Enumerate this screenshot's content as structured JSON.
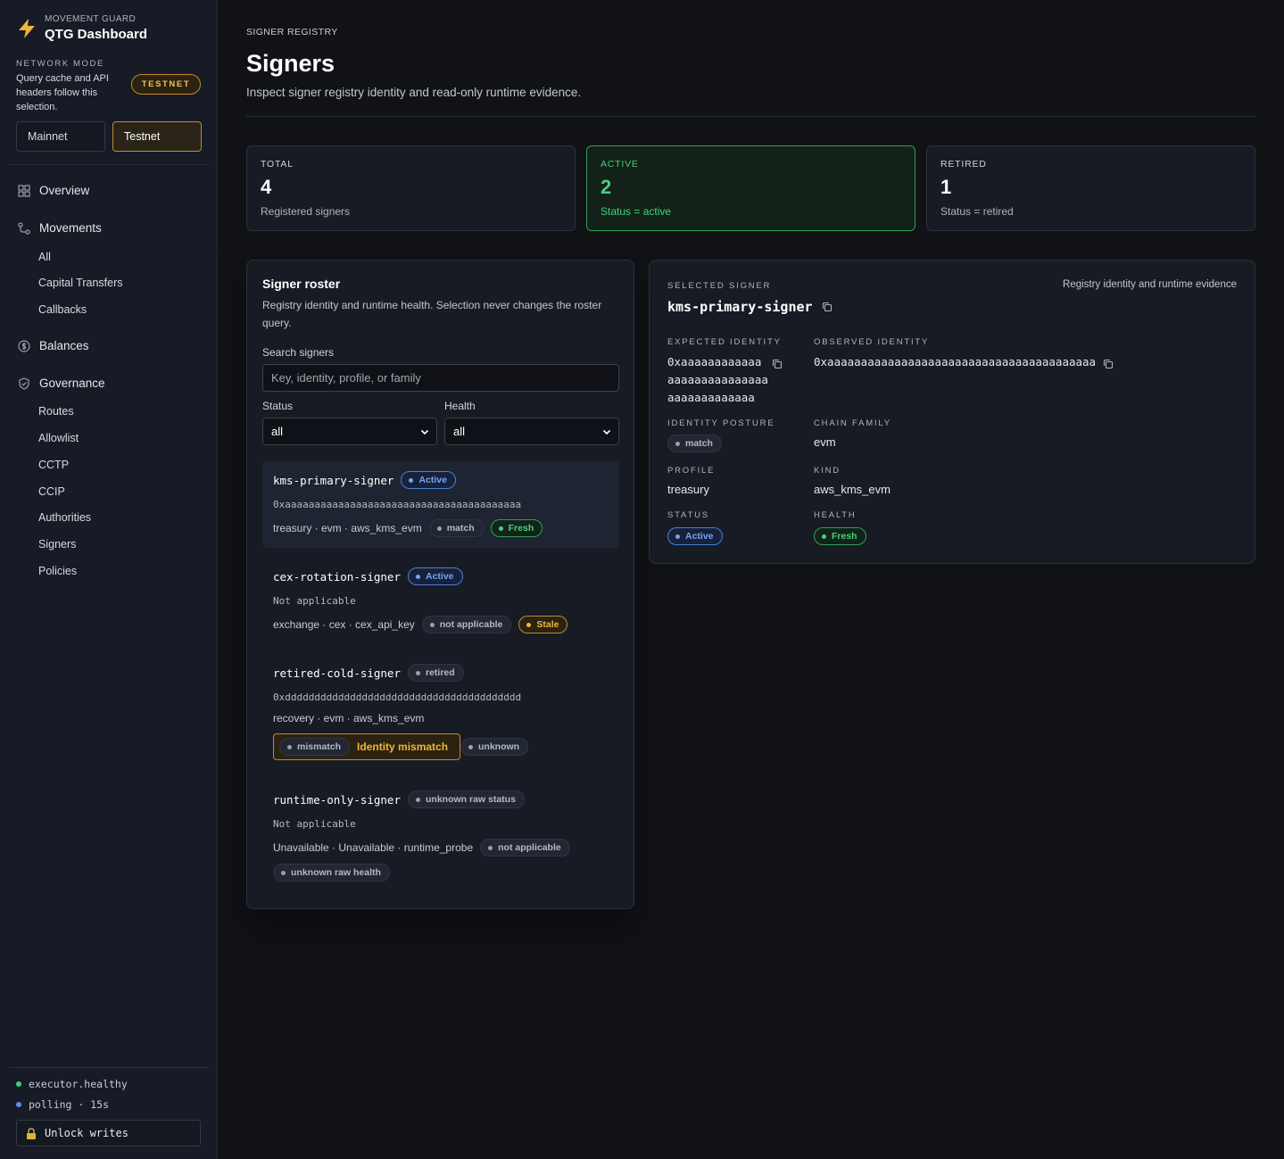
{
  "app": {
    "eyebrow": "MOVEMENT GUARD",
    "title": "QTG Dashboard",
    "accent": "#f0b43a"
  },
  "network_mode": {
    "label": "NETWORK MODE",
    "description": "Query cache and API headers follow this selection.",
    "current_badge": "TESTNET",
    "options": [
      "Mainnet",
      "Testnet"
    ],
    "selected": "Testnet"
  },
  "nav": {
    "overview": "Overview",
    "movements": "Movements",
    "movements_items": [
      "All",
      "Capital Transfers",
      "Callbacks"
    ],
    "balances": "Balances",
    "governance": "Governance",
    "governance_items": [
      "Routes",
      "Allowlist",
      "CCTP",
      "CCIP",
      "Authorities",
      "Signers",
      "Policies"
    ]
  },
  "footer": {
    "executor_status": "executor.healthy",
    "polling": "polling · 15s",
    "unlock_label": "Unlock writes"
  },
  "page": {
    "eyebrow": "SIGNER REGISTRY",
    "title": "Signers",
    "subtitle": "Inspect signer registry identity and read-only runtime evidence."
  },
  "stats": {
    "total": {
      "label": "TOTAL",
      "value": "4",
      "desc": "Registered signers"
    },
    "active": {
      "label": "ACTIVE",
      "value": "2",
      "desc": "Status = active"
    },
    "retired": {
      "label": "RETIRED",
      "value": "1",
      "desc": "Status = retired"
    }
  },
  "roster": {
    "title": "Signer roster",
    "description": "Registry identity and runtime health. Selection never changes the roster query.",
    "search_label": "Search signers",
    "search_placeholder": "Key, identity, profile, or family",
    "status_label": "Status",
    "status_value": "all",
    "health_label": "Health",
    "health_value": "all",
    "signers": [
      {
        "name": "kms-primary-signer",
        "status": "Active",
        "identity": "0xaaaaaaaaaaaaaaaaaaaaaaaaaaaaaaaaaaaaaaaa",
        "meta": "treasury · evm · aws_kms_evm",
        "posture": "match",
        "health": "Fresh"
      },
      {
        "name": "cex-rotation-signer",
        "status": "Active",
        "identity": "Not applicable",
        "meta": "exchange · cex · cex_api_key",
        "posture": "not applicable",
        "health": "Stale"
      },
      {
        "name": "retired-cold-signer",
        "status": "retired",
        "identity": "0xdddddddddddddddddddddddddddddddddddddddd",
        "meta": "recovery · evm · aws_kms_evm",
        "posture": "mismatch",
        "posture_note": "Identity mismatch",
        "health": "unknown"
      },
      {
        "name": "runtime-only-signer",
        "status": "unknown raw status",
        "identity": "Not applicable",
        "meta": "Unavailable · Unavailable · runtime_probe",
        "posture": "not applicable",
        "health": "unknown raw health"
      }
    ]
  },
  "selected": {
    "label": "SELECTED SIGNER",
    "right_note": "Registry identity and runtime evidence",
    "name": "kms-primary-signer",
    "expected_identity_label": "EXPECTED IDENTITY",
    "expected_identity": [
      "0xaaaaaaaaaaaa",
      "aaaaaaaaaaaaaaa",
      "aaaaaaaaaaaaa"
    ],
    "observed_identity_label": "OBSERVED IDENTITY",
    "observed_identity": "0xaaaaaaaaaaaaaaaaaaaaaaaaaaaaaaaaaaaaaaaa",
    "identity_posture_label": "IDENTITY POSTURE",
    "identity_posture": "match",
    "chain_family_label": "CHAIN FAMILY",
    "chain_family": "evm",
    "profile_label": "PROFILE",
    "profile": "treasury",
    "kind_label": "KIND",
    "kind": "aws_kms_evm",
    "status_label": "STATUS",
    "status": "Active",
    "health_label": "HEALTH",
    "health": "Fresh"
  }
}
